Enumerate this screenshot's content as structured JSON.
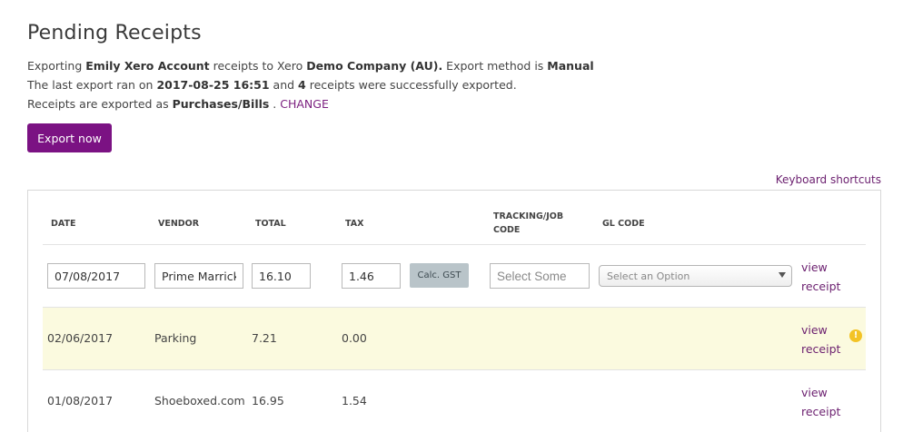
{
  "page": {
    "title": "Pending Receipts"
  },
  "info": {
    "line1": {
      "t1": "Exporting ",
      "account": "Emily Xero Account",
      "t2": " receipts to Xero ",
      "company": "Demo Company (AU).",
      "t3": " Export method is ",
      "method": "Manual"
    },
    "line2": {
      "t1": "The last export ran on ",
      "datetime": "2017-08-25 16:51",
      "t2": " and ",
      "count": "4",
      "t3": " receipts were successfully exported."
    },
    "line3": {
      "t1": "Receipts are exported as ",
      "type": "Purchases/Bills",
      "t2": " . ",
      "change_label": "CHANGE"
    }
  },
  "actions": {
    "export_label": "Export now",
    "keyboard_shortcuts_label": "Keyboard shortcuts"
  },
  "table": {
    "headers": {
      "date": "DATE",
      "vendor": "VENDOR",
      "total": "TOTAL",
      "tax": "TAX",
      "tracking_line1": "TRACKING/JOB",
      "tracking_line2": "CODE",
      "gl_code": "GL CODE"
    },
    "edit_row": {
      "date": "07/08/2017",
      "vendor": "Prime Marrickville",
      "total": "16.10",
      "tax": "1.46",
      "calc_label": "Calc. GST",
      "tracking_placeholder": "Select Some",
      "gl_placeholder": "Select an Option",
      "view_line1": "view",
      "view_line2": "receipt"
    },
    "rows": [
      {
        "date": "02/06/2017",
        "vendor": "Parking",
        "total": "7.21",
        "tax": "0.00",
        "view_line1": "view",
        "view_line2": "receipt",
        "warning_glyph": "!"
      },
      {
        "date": "01/08/2017",
        "vendor": "Shoeboxed.com",
        "total": "16.95",
        "tax": "1.54",
        "view_line1": "view",
        "view_line2": "receipt"
      }
    ]
  },
  "colors": {
    "brand_purple": "#7b1283",
    "link_purple": "#6b1f6f",
    "flag_row_bg": "#fbfadf",
    "warning_yellow": "#f3c326",
    "calc_button_bg": "#b9c4c9"
  },
  "icons": {
    "gl_dropdown": "chevron-down-icon",
    "row_warning": "warning-icon"
  }
}
